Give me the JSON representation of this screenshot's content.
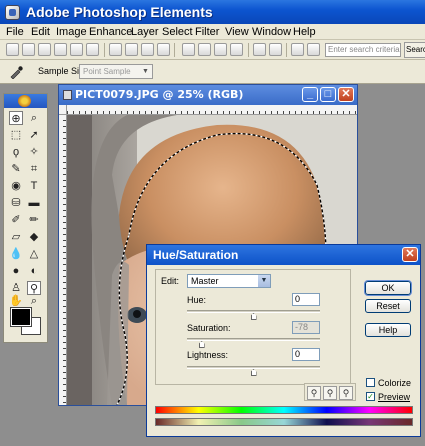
{
  "app": {
    "title": "Adobe Photoshop Elements"
  },
  "menu": [
    "File",
    "Edit",
    "Image",
    "Enhance",
    "Layer",
    "Select",
    "Filter",
    "View",
    "Window",
    "Help"
  ],
  "toolbar": {
    "search_placeholder": "Enter search criteria",
    "search_label": "Search"
  },
  "options": {
    "sample_size_label": "Sample Size:",
    "sample_size_value": "Point Sample"
  },
  "document": {
    "title": "PICT0079.JPG @ 25% (RGB)"
  },
  "dialog": {
    "title": "Hue/Saturation",
    "edit_label": "Edit:",
    "edit_value": "Master",
    "hue_label": "Hue:",
    "hue_value": "0",
    "saturation_label": "Saturation:",
    "saturation_value": "-78",
    "lightness_label": "Lightness:",
    "lightness_value": "0",
    "ok_label": "OK",
    "reset_label": "Reset",
    "help_label": "Help",
    "colorize_label": "Colorize",
    "preview_label": "Preview",
    "colorize_checked": false,
    "preview_checked": true
  },
  "colors": {
    "title_blue": "#0d55d0",
    "foreground": "#000000",
    "background": "#ffffff"
  }
}
